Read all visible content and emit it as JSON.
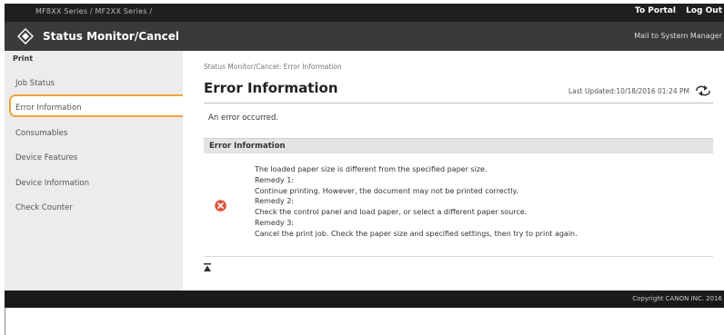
{
  "header": {
    "device_name": "MF8XX Series / MF2XX Series /",
    "portal_link": "To Portal",
    "logout_link": "Log Out"
  },
  "titlebar": {
    "app_title": "Status Monitor/Cancel",
    "mail_link": "Mail to System Manager"
  },
  "sidebar": {
    "section_label": "Print",
    "items": [
      {
        "label": "Job Status"
      },
      {
        "label": "Error Information"
      },
      {
        "label": "Consumables"
      },
      {
        "label": "Device Features"
      },
      {
        "label": "Device Information"
      },
      {
        "label": "Check Counter"
      }
    ]
  },
  "main": {
    "breadcrumb": "Status Monitor/Cancel: Error Information",
    "title": "Error Information",
    "last_updated": "Last Updated:10/18/2016 01:24 PM",
    "message": "An error occurred.",
    "section_title": "Error Information",
    "details": [
      "The loaded paper size is different from the specified paper size.",
      "Remedy 1:",
      "Continue printing. However, the document may not be printed correctly.",
      "Remedy 2:",
      "Check the control panel and load paper, or select a different paper source.",
      "Remedy 3:",
      "Cancel the print job. Check the paper size and specified settings, then try to print again."
    ]
  },
  "footer": {
    "copyright": "Copyright CANON INC. 2016"
  },
  "colors": {
    "highlight": "#f2a23a",
    "error": "#e0533d"
  }
}
